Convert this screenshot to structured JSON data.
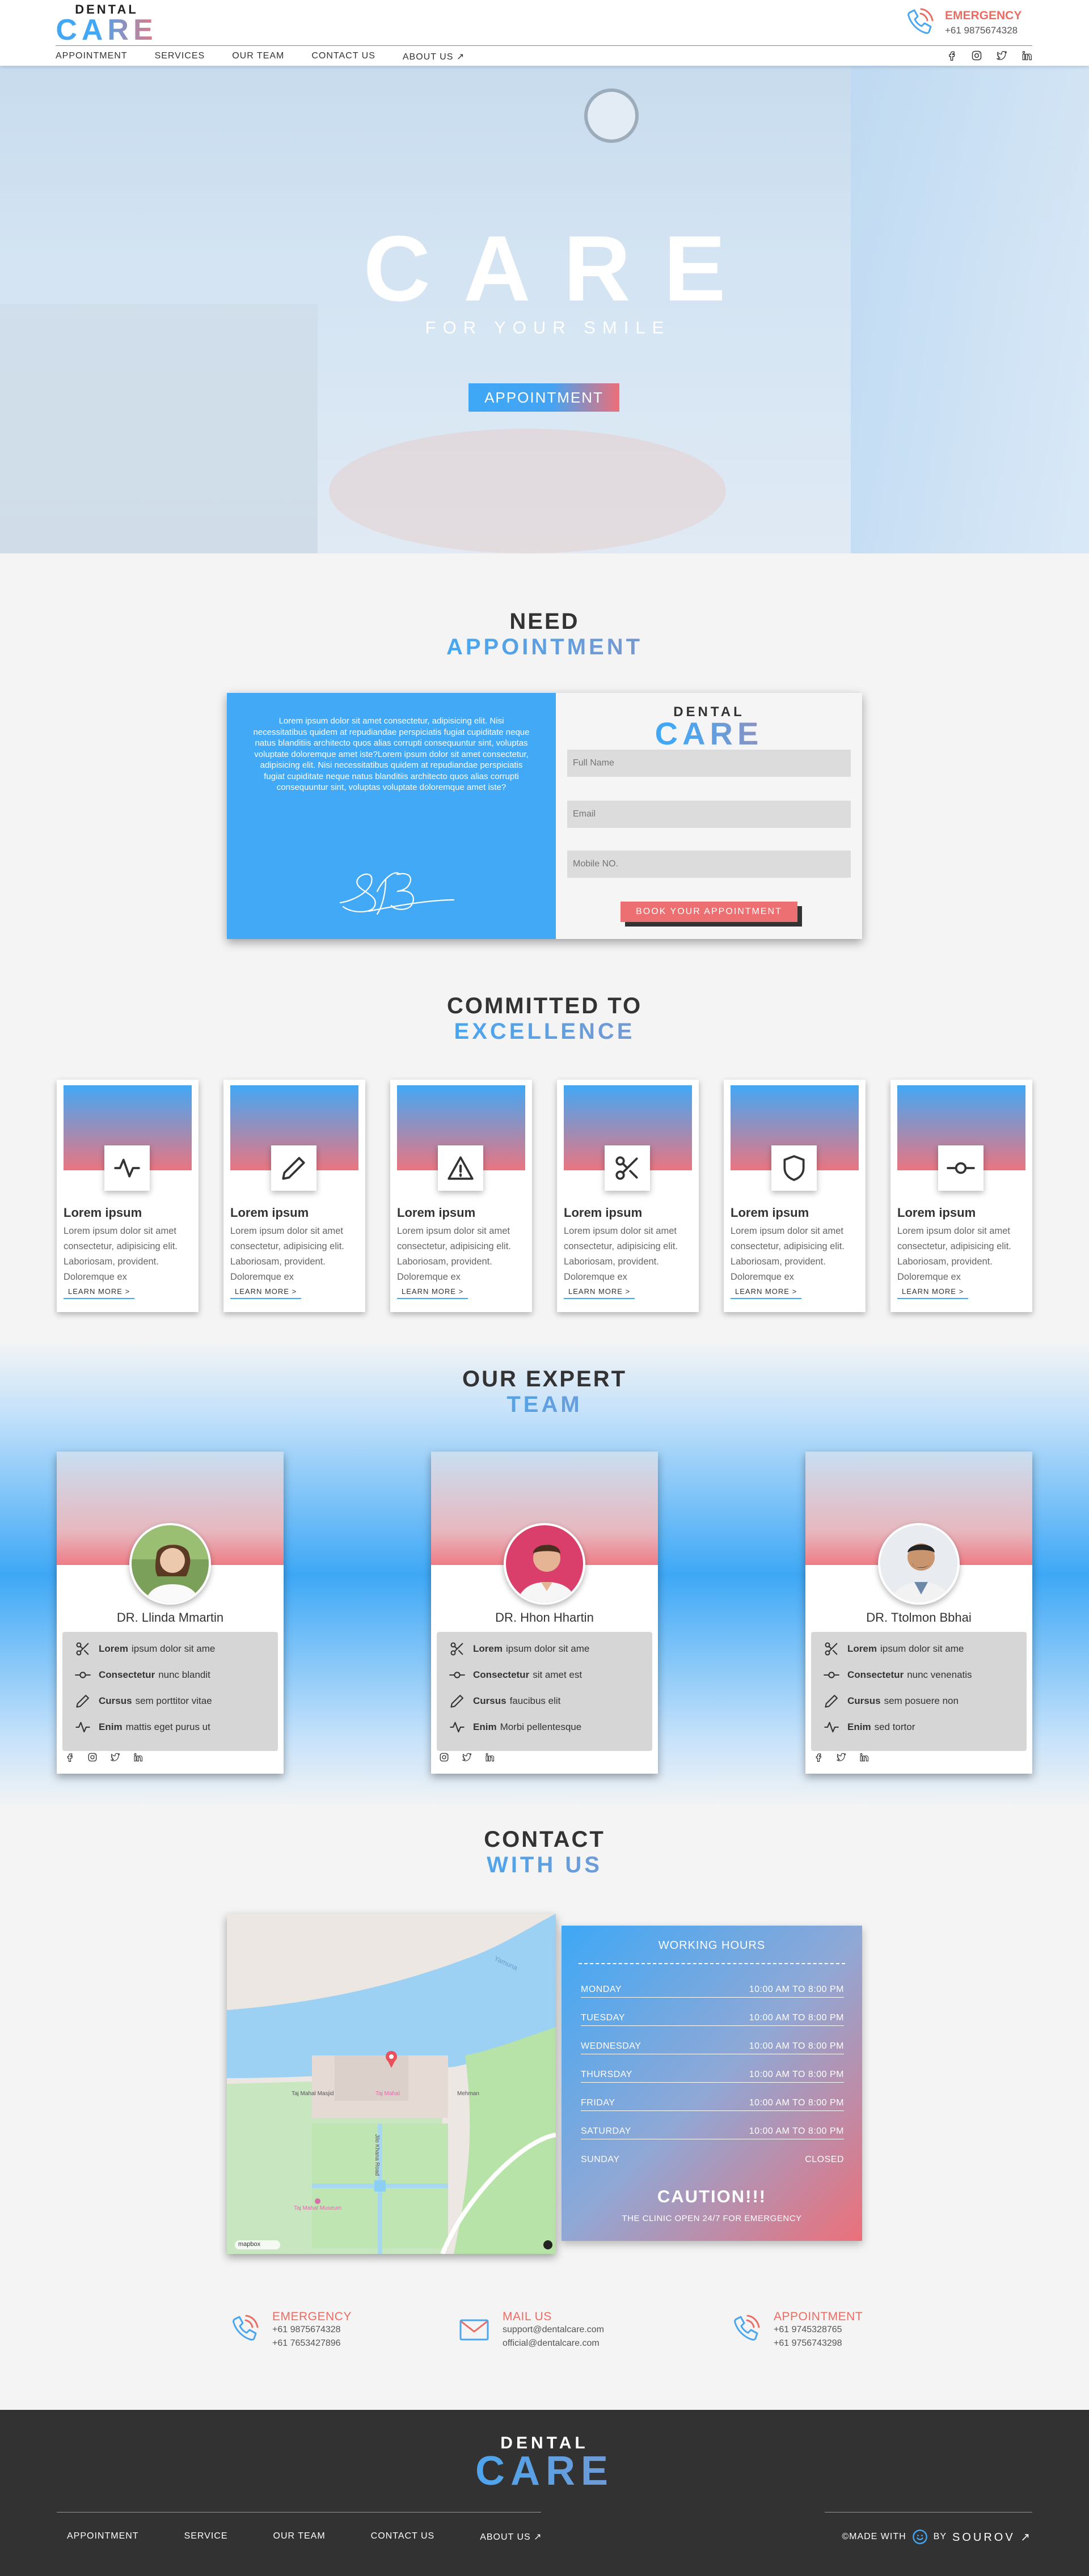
{
  "header": {
    "logo_top": "DENTAL",
    "logo_main": "CARE",
    "emergency_label": "EMERGENCY",
    "emergency_phone": "+61 9875674328",
    "nav": [
      "APPOINTMENT",
      "SERVICES",
      "OUR TEAM",
      "CONTACT US",
      "ABOUT US ↗"
    ],
    "social_icons": [
      "facebook-icon",
      "instagram-icon",
      "twitter-icon",
      "linkedin-icon"
    ]
  },
  "hero": {
    "title": "CARE",
    "subtitle": "FOR YOUR SMILE",
    "button": "APPOINTMENT"
  },
  "appointment": {
    "title_a": "NEED",
    "title_b": "APPOINTMENT",
    "text": "Lorem ipsum dolor sit amet consectetur, adipisicing elit. Nisi necessitatibus quidem at repudiandae perspiciatis fugiat cupiditate neque natus blanditiis architecto quos alias corrupti consequuntur sint, voluptas voluptate doloremque amet iste?Lorem ipsum dolor sit amet consectetur, adipisicing elit. Nisi necessitatibus quidem at repudiandae perspiciatis fugiat cupiditate neque natus blanditiis architecto quos alias corrupti consequuntur sint, voluptas voluptate doloremque amet iste?",
    "logo_top": "DENTAL",
    "logo_main": "CARE",
    "fields": {
      "name": "Full Name",
      "email": "Email",
      "mobile": "Mobile NO."
    },
    "button": "BOOK YOUR APPOINTMENT"
  },
  "excellence": {
    "title_a": "COMMITTED TO",
    "title_b": "EXCELLENCE",
    "cards": [
      {
        "icon": "pulse-icon",
        "title": "Lorem ipsum",
        "text": "Lorem ipsum dolor sit amet consectetur, adipisicing elit. Laboriosam, provident. Doloremque ex",
        "link": "LEARN MORE >"
      },
      {
        "icon": "pencil-icon",
        "title": "Lorem ipsum",
        "text": "Lorem ipsum dolor sit amet consectetur, adipisicing elit. Laboriosam, provident. Doloremque ex",
        "link": "LEARN MORE >"
      },
      {
        "icon": "warning-icon",
        "title": "Lorem ipsum",
        "text": "Lorem ipsum dolor sit amet consectetur, adipisicing elit. Laboriosam, provident. Doloremque ex",
        "link": "LEARN MORE >"
      },
      {
        "icon": "scissors-icon",
        "title": "Lorem ipsum",
        "text": "Lorem ipsum dolor sit amet consectetur, adipisicing elit. Laboriosam, provident. Doloremque ex",
        "link": "LEARN MORE >"
      },
      {
        "icon": "shield-icon",
        "title": "Lorem ipsum",
        "text": "Lorem ipsum dolor sit amet consectetur, adipisicing elit. Laboriosam, provident. Doloremque ex",
        "link": "LEARN MORE >"
      },
      {
        "icon": "commit-icon",
        "title": "Lorem ipsum",
        "text": "Lorem ipsum dolor sit amet consectetur, adipisicing elit. Laboriosam, provident. Doloremque ex",
        "link": "LEARN MORE >"
      }
    ]
  },
  "team": {
    "title_a": "OUR EXPERT",
    "title_b": "TEAM",
    "members": [
      {
        "name": "DR. Llinda Mmartin",
        "skills": [
          {
            "icon": "scissors-icon",
            "bold": "Lorem",
            "rest": "ipsum dolor sit ame"
          },
          {
            "icon": "commit-icon",
            "bold": "Consectetur",
            "rest": "nunc blandit"
          },
          {
            "icon": "pencil-icon",
            "bold": "Cursus",
            "rest": "sem porttitor vitae"
          },
          {
            "icon": "pulse-icon",
            "bold": "Enim",
            "rest": "mattis eget purus ut"
          }
        ],
        "social": [
          "facebook-icon",
          "instagram-icon",
          "twitter-icon",
          "linkedin-icon"
        ]
      },
      {
        "name": "DR. Hhon Hhartin",
        "skills": [
          {
            "icon": "scissors-icon",
            "bold": "Lorem",
            "rest": "ipsum dolor sit ame"
          },
          {
            "icon": "commit-icon",
            "bold": "Consectetur",
            "rest": "sit amet est"
          },
          {
            "icon": "pencil-icon",
            "bold": "Cursus",
            "rest": "faucibus elit"
          },
          {
            "icon": "pulse-icon",
            "bold": "Enim",
            "rest": "Morbi pellentesque"
          }
        ],
        "social": [
          "instagram-icon",
          "twitter-icon",
          "linkedin-icon"
        ]
      },
      {
        "name": "DR. Ttolmon Bbhai",
        "skills": [
          {
            "icon": "scissors-icon",
            "bold": "Lorem",
            "rest": "ipsum dolor sit ame"
          },
          {
            "icon": "commit-icon",
            "bold": "Consectetur",
            "rest": "nunc venenatis"
          },
          {
            "icon": "pencil-icon",
            "bold": "Cursus",
            "rest": "sem posuere non"
          },
          {
            "icon": "pulse-icon",
            "bold": "Enim",
            "rest": "sed tortor"
          }
        ],
        "social": [
          "facebook-icon",
          "twitter-icon",
          "linkedin-icon"
        ]
      }
    ]
  },
  "contact": {
    "title_a": "CONTACT",
    "title_b": "WITH US",
    "map": {
      "river": "Yamuna",
      "place1": "Taj Mahal Masjid",
      "place2": "Taj Mahal",
      "place3": "Mehman",
      "place4": "Taj Mahal Museum",
      "road": "Jilo Khana Road",
      "attribution": "mapbox"
    },
    "hours_title": "WORKING HOURS",
    "hours": [
      {
        "day": "MONDAY",
        "time": "10:00 AM TO 8:00 PM"
      },
      {
        "day": "TUESDAY",
        "time": "10:00 AM TO 8:00 PM"
      },
      {
        "day": "WEDNESDAY",
        "time": "10:00 AM TO 8:00 PM"
      },
      {
        "day": "THURSDAY",
        "time": "10:00 AM TO 8:00 PM"
      },
      {
        "day": "FRIDAY",
        "time": "10:00 AM TO 8:00 PM"
      },
      {
        "day": "SATURDAY",
        "time": "10:00 AM TO 8:00 PM"
      },
      {
        "day": "SUNDAY",
        "time": "CLOSED"
      }
    ],
    "caution": "CAUTION!!!",
    "open_note": "THE CLINIC OPEN 24/7 FOR EMERGENCY",
    "info": [
      {
        "icon": "phone-icon",
        "title": "EMERGENCY",
        "l1": "+61 9875674328",
        "l2": "+61 7653427896"
      },
      {
        "icon": "mail-icon",
        "title": "MAIL US",
        "l1": "support@dentalcare.com",
        "l2": "official@dentalcare.com"
      },
      {
        "icon": "phone-icon",
        "title": "APPOINTMENT",
        "l1": "+61 9745328765",
        "l2": "+61 9756743298"
      }
    ]
  },
  "footer": {
    "logo_top": "DENTAL",
    "logo_main": "CARE",
    "nav": [
      "APPOINTMENT",
      "SERVICE",
      "OUR TEAM",
      "CONTACT US",
      "ABOUT US ↗"
    ],
    "made_with": "©MADE WITH",
    "by": "BY",
    "author": "SOUROV ↗"
  },
  "colors": {
    "blue": "#42a8f5",
    "coral": "#ea7580",
    "dark": "#323232"
  }
}
